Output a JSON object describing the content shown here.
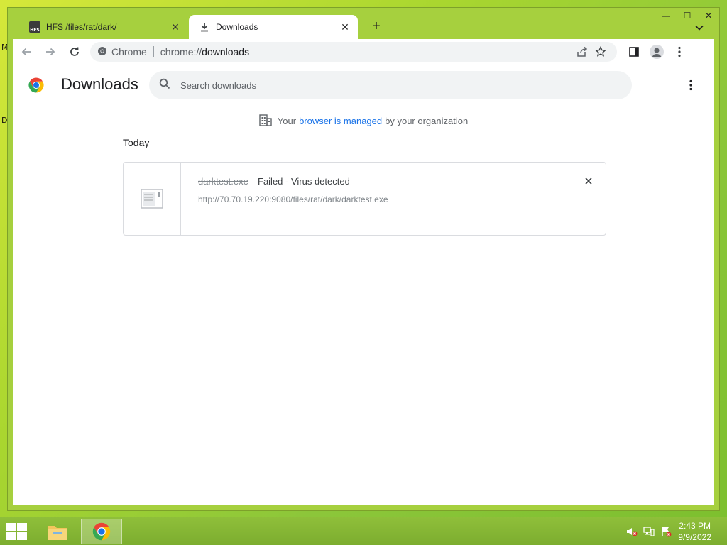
{
  "desktop": {
    "edge_text_top": "M",
    "edge_text_bottom": "D"
  },
  "browser": {
    "window_buttons": {
      "minimize": "—",
      "maximize": "☐",
      "close": "✕"
    },
    "tabs": [
      {
        "title": "HFS /files/rat/dark/",
        "favicon_text": "HFS",
        "favicon": "hfs-icon",
        "active": false
      },
      {
        "title": "Downloads",
        "favicon": "download-icon",
        "active": true
      }
    ],
    "new_tab_label": "+",
    "omnibox": {
      "site_label": "Chrome",
      "url_scheme": "chrome://",
      "url_host": "downloads"
    }
  },
  "downloads_page": {
    "title": "Downloads",
    "search_placeholder": "Search downloads",
    "managed_notice": {
      "prefix": "Your",
      "link": "browser is managed",
      "suffix": "by your organization"
    },
    "date_group": "Today",
    "items": [
      {
        "file_name": "darktest.exe",
        "status": "Failed - Virus detected",
        "url": "http://70.70.19.220:9080/files/rat/dark/darktest.exe"
      }
    ]
  },
  "taskbar": {
    "clock_time": "2:43 PM",
    "clock_date": "9/9/2022"
  },
  "colors": {
    "accent": "#1a73e8",
    "window_frame": "#a6d03e"
  }
}
